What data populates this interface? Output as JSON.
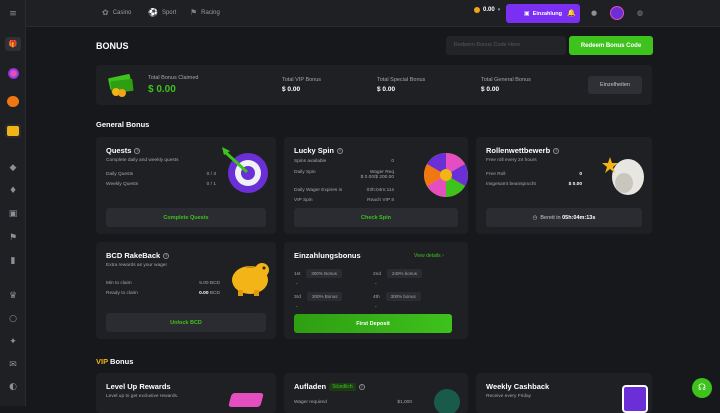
{
  "sidebar": {
    "items": [
      {
        "icon": "menu-icon",
        "glyph": "≡"
      },
      {
        "icon": "gift-icon",
        "glyph": "⬛"
      },
      {
        "icon": "spin-icon",
        "glyph": "●"
      },
      {
        "icon": "pumpkin-icon",
        "glyph": "●"
      },
      {
        "icon": "chest-icon",
        "glyph": "●"
      },
      {
        "icon": "tag-icon",
        "glyph": "◆"
      },
      {
        "icon": "vip-icon",
        "glyph": "♦"
      },
      {
        "icon": "dice-icon",
        "glyph": "▣"
      },
      {
        "icon": "flag-icon",
        "glyph": "⚑"
      },
      {
        "icon": "chart-icon",
        "glyph": "▮"
      },
      {
        "icon": "crown-icon",
        "glyph": "♛"
      },
      {
        "icon": "circle-icon",
        "glyph": "○"
      },
      {
        "icon": "forum-icon",
        "glyph": "✦"
      },
      {
        "icon": "chat-icon",
        "glyph": "✉"
      }
    ]
  },
  "topbar": {
    "nav": [
      {
        "label": "Casino",
        "icon": "casino-icon",
        "glyph": "✿"
      },
      {
        "label": "Sport",
        "icon": "sport-icon",
        "glyph": "⚽"
      },
      {
        "label": "Racing",
        "icon": "racing-icon",
        "glyph": "⚑"
      }
    ],
    "balance": "0.00",
    "deposit": "Einzahlung"
  },
  "page": {
    "title": "BONUS",
    "code_placeholder": "Redeem Bonus Code Here",
    "redeem": "Redeem Bonus Code"
  },
  "summary": {
    "total_label": "Total Bonus Claimed",
    "total_value": "$ 0.00",
    "vip_label": "Total VIP Bonus",
    "vip_value": "$ 0.00",
    "special_label": "Total Special Bonus",
    "special_value": "$ 0.00",
    "general_label": "Total General Bonus",
    "general_value": "$ 0.00",
    "details": "Einzelheiten"
  },
  "general": {
    "title": "General Bonus",
    "quests": {
      "title": "Quests",
      "sub": "Complete daily and weekly quests",
      "daily": "Daily Quests",
      "daily_v": "0 / 3",
      "weekly": "Weekly Quests",
      "weekly_v": "0 / 1",
      "btn": "Complete Quests"
    },
    "lucky": {
      "title": "Lucky Spin",
      "available": "Spins available",
      "available_v": "0",
      "daily": "Daily Spin",
      "wager_req": "Wager Req",
      "wager_v": "$ 0.00/$ 200.00",
      "expires": "Daily Wager Expires in",
      "expires_v": "03h:04m:11s",
      "vip": "VIP Spin",
      "vip_v": "Reach VIP 8",
      "btn": "Check Spin"
    },
    "roll": {
      "title": "Rollenwettbewerb",
      "sub": "Free roll every 24 hours",
      "free": "Free Roll",
      "free_v": "0",
      "total": "Insgesamt beansprucht",
      "total_v": "$ 0.00",
      "ready": "Bereit in",
      "ready_v": "05h:04m:13s"
    },
    "rake": {
      "title": "BCD RakeBack",
      "sub": "Extra rewards as your wager",
      "min": "Min to claim",
      "min_v": "5.00 BCD",
      "ready": "Ready to claim",
      "ready_v": "0.00",
      "ready_unit": "BCD",
      "btn": "Unlock BCD"
    },
    "deposit": {
      "title": "Einzahlungsbonus",
      "link": "View details",
      "b1": "1st",
      "b1v": "300% Bonus",
      "b2": "2nd",
      "b2v": "240% bonus",
      "b3": "3rd",
      "b3v": "300% Bonus",
      "b4": "4th",
      "b4v": "300% bonus",
      "dash": "-",
      "btn": "First Deposit"
    }
  },
  "vip": {
    "title_accent": "VIP",
    "title_rest": "Bonus",
    "levelup": {
      "title": "Level Up Rewards",
      "sub": "Level up to get exclusive rewards."
    },
    "recharge": {
      "title": "Aufladen",
      "badge": "Stündlich",
      "wager": "Wager required",
      "wager_v": "$1,000"
    },
    "cashback": {
      "title": "Weekly Cashback",
      "sub": "Receive every Friday"
    }
  },
  "colors": {
    "green": "#3ec21c",
    "purple": "#7b2ff2",
    "card": "#1f2023",
    "bg": "#17181b"
  }
}
